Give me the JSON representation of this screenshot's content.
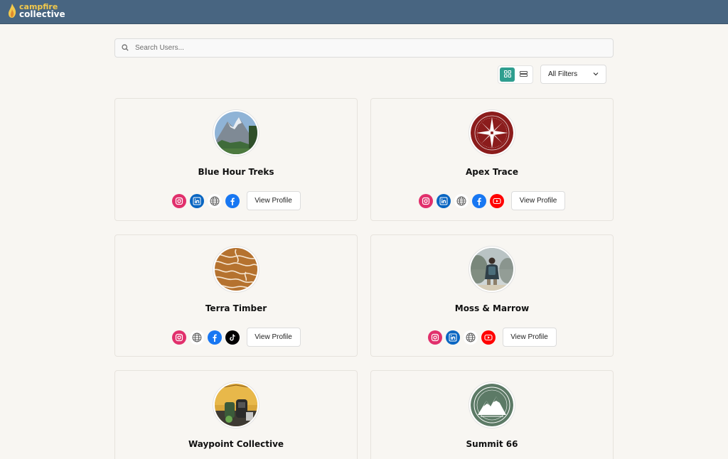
{
  "app": {
    "logo_line1": "campfire",
    "logo_line2": "collective"
  },
  "search": {
    "placeholder": "Search Users..."
  },
  "toolbar": {
    "filters_label": "All Filters"
  },
  "colors": {
    "header": "#486581",
    "accent": "#2f9e8f",
    "instagram": "#e1306c",
    "linkedin": "#0a66c2",
    "website": "#6b6b6b",
    "facebook": "#1877f2",
    "youtube": "#ff0000",
    "tiktok": "#000000"
  },
  "cards": [
    {
      "name": "Blue Hour Treks",
      "avatar": "mountain-photo",
      "socials": [
        "instagram",
        "linkedin",
        "website",
        "facebook"
      ],
      "button": "View Profile"
    },
    {
      "name": "Apex Trace",
      "avatar": "compass-logo",
      "socials": [
        "instagram",
        "linkedin",
        "website",
        "facebook",
        "youtube"
      ],
      "button": "View Profile"
    },
    {
      "name": "Terra Timber",
      "avatar": "topographic-logo",
      "socials": [
        "instagram",
        "website",
        "facebook",
        "tiktok"
      ],
      "button": "View Profile"
    },
    {
      "name": "Moss & Marrow",
      "avatar": "hiker-photo",
      "socials": [
        "instagram",
        "linkedin",
        "website",
        "youtube"
      ],
      "button": "View Profile"
    },
    {
      "name": "Waypoint Collective",
      "avatar": "camp-gear-photo",
      "socials": [],
      "button": ""
    },
    {
      "name": "Summit 66",
      "avatar": "mountain-badge-logo",
      "socials": [],
      "button": ""
    }
  ]
}
